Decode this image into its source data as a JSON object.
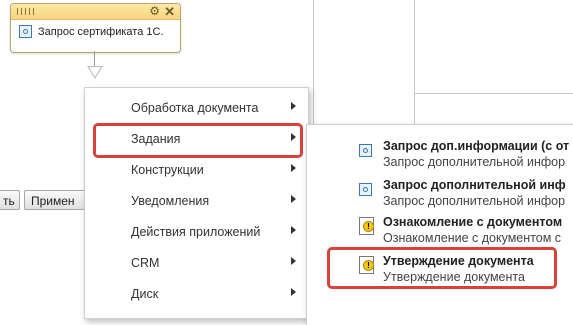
{
  "activity": {
    "label": "Запрос сертификата 1С.",
    "gear": "⚙",
    "close": "✕"
  },
  "background_buttons": [
    "ть",
    "Примен"
  ],
  "menu": {
    "items": [
      {
        "label": "Обработка документа"
      },
      {
        "label": "Задания"
      },
      {
        "label": "Конструкции"
      },
      {
        "label": "Уведомления"
      },
      {
        "label": "Действия приложений"
      },
      {
        "label": "CRM"
      },
      {
        "label": "Диск"
      }
    ]
  },
  "submenu": {
    "items": [
      {
        "title": "Запрос доп.информации (с от",
        "desc": "Запрос дополнительной инфор",
        "icon": "activity-icon"
      },
      {
        "title": "Запрос дополнительной инф",
        "desc": "Запрос дополнительной инфор",
        "icon": "activity-icon"
      },
      {
        "title": "Ознакомление с документом",
        "desc": "Ознакомление с документом с",
        "icon": "document-warning-icon"
      },
      {
        "title": "Утверждение документа",
        "desc": "Утверждение документа",
        "icon": "document-warning-icon"
      }
    ]
  },
  "colors": {
    "highlight": "#d7423c",
    "activity_header": "#f7d47b"
  }
}
